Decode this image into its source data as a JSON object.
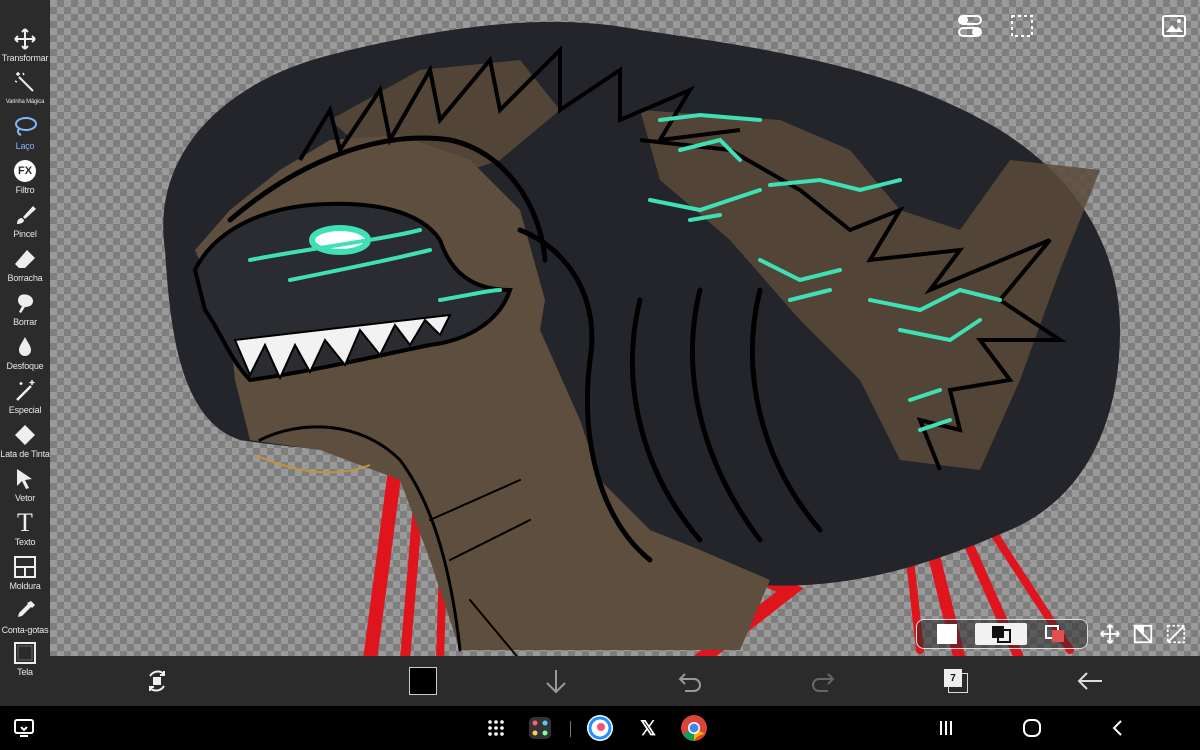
{
  "tools": [
    {
      "label": "Transformar",
      "icon": "move-arrows-icon"
    },
    {
      "label": "Varinha Mágica",
      "icon": "magic-wand-icon"
    },
    {
      "label": "Laço",
      "icon": "lasso-icon",
      "active": true
    },
    {
      "label": "Filtro",
      "icon": "fx-icon"
    },
    {
      "label": "Pincel",
      "icon": "brush-icon"
    },
    {
      "label": "Borracha",
      "icon": "eraser-icon"
    },
    {
      "label": "Borrar",
      "icon": "smudge-icon"
    },
    {
      "label": "Desfoque",
      "icon": "blur-drop-icon"
    },
    {
      "label": "Especial",
      "icon": "sparkle-wand-icon"
    },
    {
      "label": "Lata de Tinta",
      "icon": "paint-bucket-icon"
    },
    {
      "label": "Vetor",
      "icon": "vector-cursor-icon"
    },
    {
      "label": "Texto",
      "icon": "text-icon"
    },
    {
      "label": "Moldura",
      "icon": "frame-icon"
    },
    {
      "label": "Conta-gotas",
      "icon": "eyedropper-icon"
    },
    {
      "label": "Tela",
      "icon": "canvas-icon"
    }
  ],
  "fx_glyph": "FX",
  "text_glyph": "T",
  "bottom": {
    "primary_color": "#000000",
    "layer_count": "7"
  },
  "colors": {
    "toolbar_bg": "#2b2b2b",
    "active_tool": "#7fb8ff",
    "accent_glow": "#3fe0b5",
    "dark_body": "#23252b",
    "brown_skin": "#5a4a3a",
    "red_strokes": "#e0141c"
  },
  "navbar": {
    "apps": [
      "app-drawer-icon",
      "edge-panel-icon",
      "ibispaint-icon",
      "x-app-icon",
      "chrome-icon"
    ],
    "x_glyph": "𝕏"
  }
}
